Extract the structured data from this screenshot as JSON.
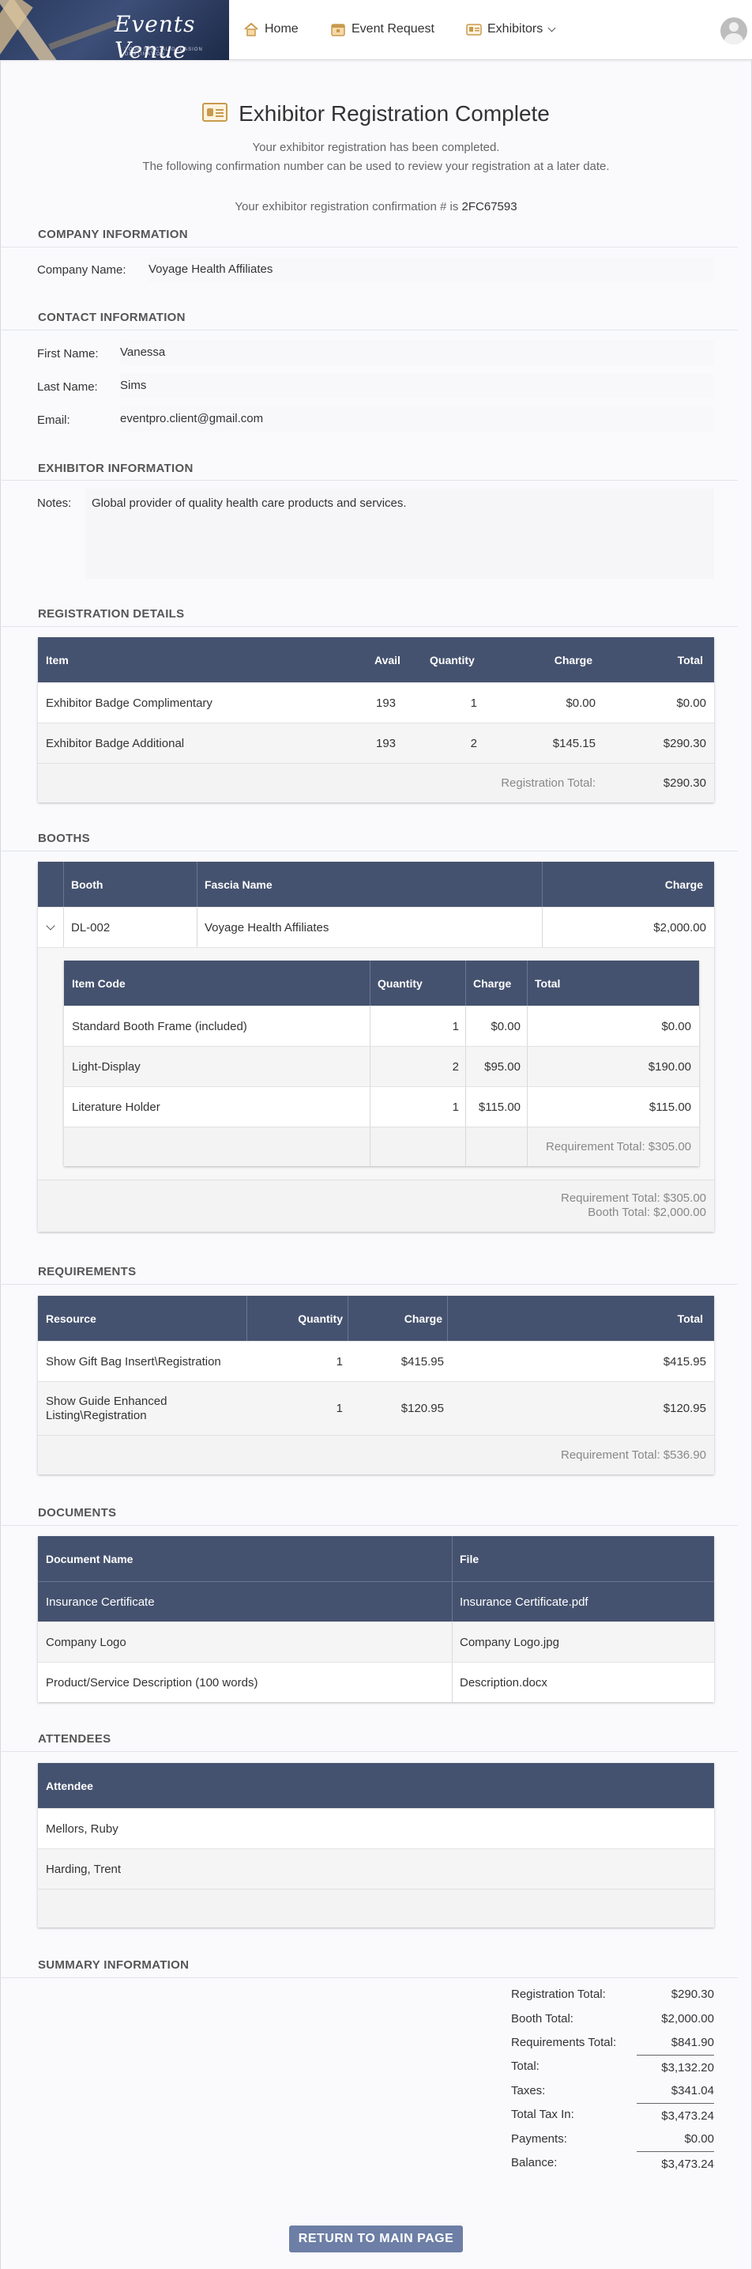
{
  "nav": {
    "logo_text": "Events Venue",
    "logo_tagline": "YOUR SPECIAL OCCASION DESTINATION",
    "home": "Home",
    "event_request": "Event Request",
    "exhibitors": "Exhibitors"
  },
  "header": {
    "title": "Exhibitor Registration Complete",
    "line1": "Your exhibitor registration has been completed.",
    "line2": "The following confirmation number can be used to review your registration at a later date.",
    "confirm_prefix": "Your exhibitor registration confirmation # is",
    "confirm_number": "2FC67593"
  },
  "company": {
    "section": "COMPANY INFORMATION",
    "name_label": "Company Name:",
    "name_value": "Voyage Health Affiliates"
  },
  "contact": {
    "section": "CONTACT INFORMATION",
    "first_label": "First Name:",
    "first_value": "Vanessa",
    "last_label": "Last Name:",
    "last_value": "Sims",
    "email_label": "Email:",
    "email_value": "eventpro.client@gmail.com"
  },
  "exhibitor": {
    "section": "EXHIBITOR INFORMATION",
    "notes_label": "Notes:",
    "notes_value": "Global provider of quality health care products and services."
  },
  "registration": {
    "section": "REGISTRATION DETAILS",
    "headers": [
      "Item",
      "Avail",
      "Quantity",
      "Charge",
      "Total"
    ],
    "rows": [
      [
        "Exhibitor Badge Complimentary",
        "193",
        "1",
        "$0.00",
        "$0.00"
      ],
      [
        "Exhibitor Badge Additional",
        "193",
        "2",
        "$145.15",
        "$290.30"
      ]
    ],
    "total_label": "Registration Total:",
    "total_value": "$290.30"
  },
  "booths": {
    "section": "BOOTHS",
    "headers": [
      "Booth",
      "Fascia Name",
      "Charge"
    ],
    "row": [
      "DL-002",
      "Voyage Health Affiliates",
      "$2,000.00"
    ],
    "sub_headers": [
      "Item Code",
      "Quantity",
      "Charge",
      "Total"
    ],
    "sub_rows": [
      [
        "Standard Booth Frame (included)",
        "1",
        "$0.00",
        "$0.00"
      ],
      [
        "Light-Display",
        "2",
        "$95.00",
        "$190.00"
      ],
      [
        "Literature Holder",
        "1",
        "$115.00",
        "$115.00"
      ]
    ],
    "sub_total": "Requirement Total: $305.00",
    "foot_req": "Requirement Total: $305.00",
    "foot_booth": "Booth Total: $2,000.00"
  },
  "requirements": {
    "section": "REQUIREMENTS",
    "headers": [
      "Resource",
      "Quantity",
      "Charge",
      "Total"
    ],
    "rows": [
      [
        "Show Gift Bag Insert\\Registration",
        "1",
        "$415.95",
        "$415.95"
      ],
      [
        "Show Guide Enhanced Listing\\Registration",
        "1",
        "$120.95",
        "$120.95"
      ]
    ],
    "total": "Requirement Total: $536.90"
  },
  "documents": {
    "section": "DOCUMENTS",
    "headers": [
      "Document Name",
      "File"
    ],
    "rows": [
      [
        "Insurance Certificate",
        "Insurance Certificate.pdf"
      ],
      [
        "Company Logo",
        "Company Logo.jpg"
      ],
      [
        "Product/Service Description (100 words)",
        "Description.docx"
      ]
    ]
  },
  "attendees": {
    "section": "ATTENDEES",
    "header": "Attendee",
    "rows": [
      "Mellors, Ruby",
      "Harding, Trent"
    ]
  },
  "summary": {
    "section": "SUMMARY INFORMATION",
    "items": [
      [
        "Registration Total:",
        "$290.30"
      ],
      [
        "Booth Total:",
        "$2,000.00"
      ],
      [
        "Requirements Total:",
        "$841.90"
      ],
      [
        "Total:",
        "$3,132.20"
      ],
      [
        "Taxes:",
        "$341.04"
      ],
      [
        "Total Tax In:",
        "$3,473.24"
      ],
      [
        "Payments:",
        "$0.00"
      ],
      [
        "Balance:",
        "$3,473.24"
      ]
    ]
  },
  "actions": {
    "return_label": "RETURN TO MAIN PAGE"
  }
}
